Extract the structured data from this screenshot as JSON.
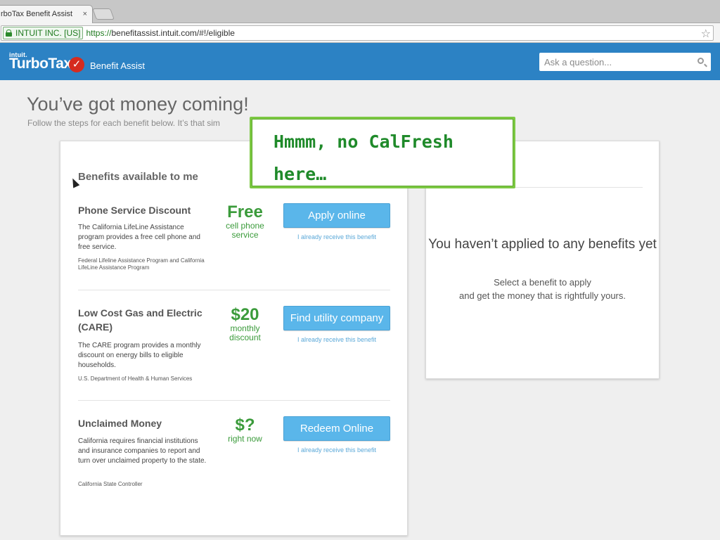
{
  "browser": {
    "tab_title": "rboTax Benefit Assist",
    "tab_close": "×",
    "ev_label": "INTUIT INC. [US]",
    "url_scheme": "https://",
    "url_rest": "benefitassist.intuit.com/#!/eligible",
    "star_icon": "☆"
  },
  "header": {
    "brand_small": "intuit.",
    "brand": "TurboTax",
    "check_mark": "✓",
    "product": "Benefit Assist",
    "search_placeholder": "Ask a question...",
    "background_color": "#2c82c4"
  },
  "page": {
    "title": "You’ve got money coming!",
    "subtitle": "Follow the steps for each benefit below. It’s that sim"
  },
  "benefits_card": {
    "title": "Benefits available to me",
    "items": [
      {
        "name": "Phone Service Discount",
        "description": "The California LifeLine Assistance program provides a free cell phone and free service.",
        "source": "Federal Lifeline Assistance Program and California LifeLine Assistance Program",
        "amount": "Free",
        "amount_detail": "cell phone service",
        "button": "Apply online",
        "already": "I already receive this benefit"
      },
      {
        "name": "Low Cost Gas and Electric (CARE)",
        "description": "The CARE program provides a monthly discount on energy bills to eligible households.",
        "source": "U.S. Department of Health & Human Services",
        "amount": "$20",
        "amount_detail": "monthly discount",
        "button": "Find utility company",
        "already": "I already receive this benefit"
      },
      {
        "name": "Unclaimed Money",
        "description": "California requires financial institutions and insurance companies to report and turn over unclaimed property to the state.",
        "source": "California State Controller",
        "amount": "$?",
        "amount_detail": "right now",
        "button": "Redeem Online",
        "already": "I already receive this benefit"
      }
    ]
  },
  "applied_card": {
    "empty_title": "You haven’t applied to any benefits yet",
    "empty_line1": "Select a benefit to apply",
    "empty_line2": "and get the money that is rightfully yours."
  },
  "annotation": {
    "text": "Hmmm, no CalFresh here…",
    "border_color": "#7cc843",
    "text_color": "#1f8a2a"
  },
  "colors": {
    "accent_green": "#3b9b3b",
    "button_blue": "#5ab6ea",
    "link_blue": "#5aa8d8"
  }
}
